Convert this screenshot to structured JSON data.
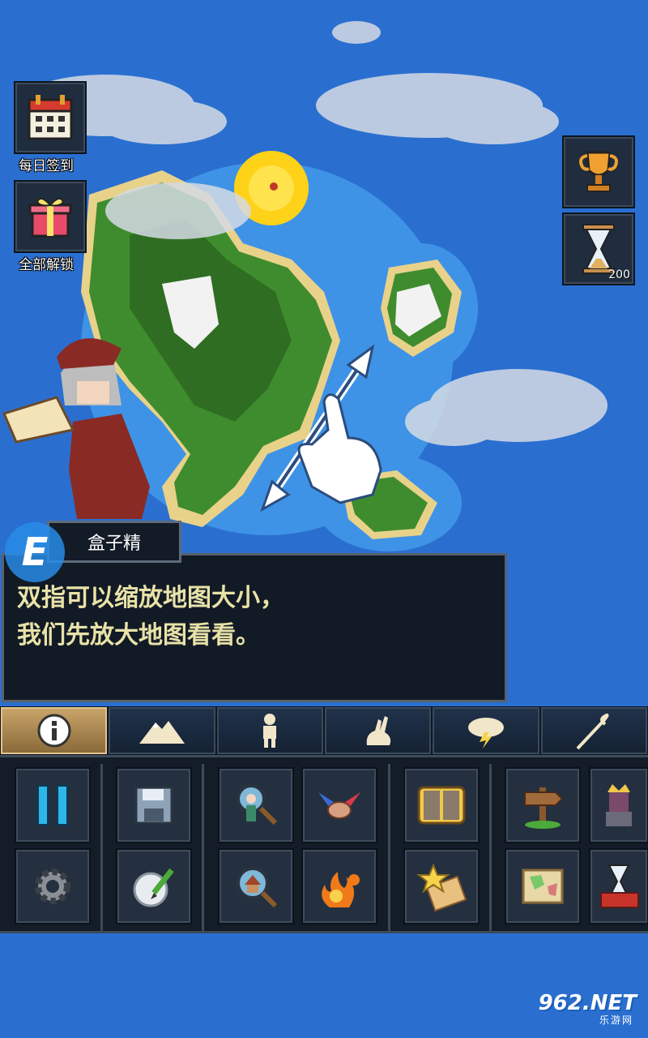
{
  "side_buttons": {
    "daily_checkin": {
      "label": "每日签到",
      "icon": "calendar-icon"
    },
    "unlock_all": {
      "label": "全部解锁",
      "icon": "gift-box-icon"
    },
    "achievements": {
      "icon": "trophy-icon"
    },
    "time_speed": {
      "icon": "hourglass-icon",
      "count": "200"
    }
  },
  "tutorial": {
    "speaker": "盒子精",
    "message": "双指可以缩放地图大小，\n我们先放大地图看看。",
    "gesture_icon": "pinch-zoom-hand-icon"
  },
  "tabs": [
    {
      "icon": "info-icon",
      "active": true
    },
    {
      "icon": "mountain-icon",
      "active": false
    },
    {
      "icon": "human-icon",
      "active": false
    },
    {
      "icon": "rabbit-icon",
      "active": false
    },
    {
      "icon": "storm-cloud-icon",
      "active": false
    },
    {
      "icon": "staff-icon",
      "active": false
    }
  ],
  "tools": [
    {
      "icon": "pause-icon"
    },
    {
      "icon": "settings-gear-icon"
    },
    {
      "icon": "save-floppy-icon"
    },
    {
      "icon": "edit-world-icon"
    },
    {
      "icon": "inspect-unit-icon"
    },
    {
      "icon": "inspect-village-icon"
    },
    {
      "icon": "diplomacy-icon"
    },
    {
      "icon": "war-fire-icon"
    },
    {
      "icon": "history-book-icon"
    },
    {
      "icon": "favorites-scroll-icon"
    },
    {
      "icon": "signpost-icon"
    },
    {
      "icon": "world-map-icon"
    },
    {
      "icon": "king-icon"
    },
    {
      "icon": "world-laws-icon"
    }
  ],
  "watermark": {
    "main": "962.NET",
    "sub": "乐游网"
  },
  "colors": {
    "ocean": "#2a6fd0",
    "dialog_text": "#e8e2a8",
    "panel": "#131c27",
    "active_tab": "#c9a46a"
  }
}
